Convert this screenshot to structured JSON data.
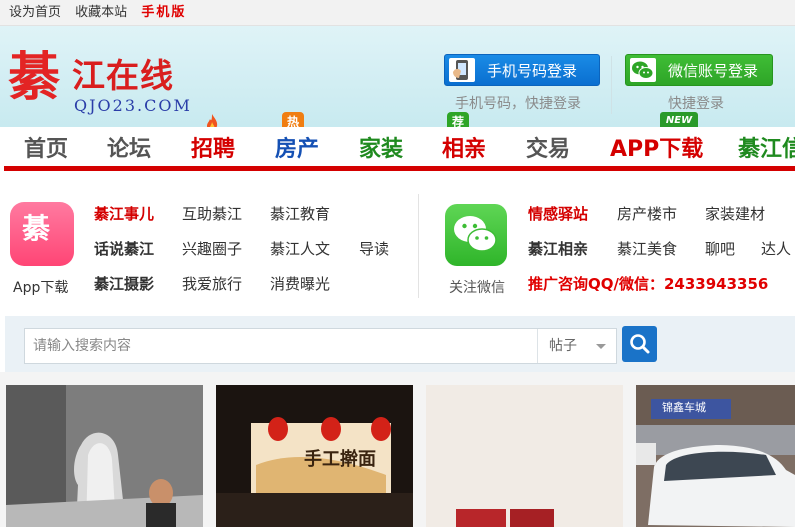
{
  "topbar": {
    "set_home": "设为首页",
    "bookmark": "收藏本站",
    "mobile": "手机版"
  },
  "logo": {
    "char": "綦",
    "name": "江在线",
    "domain": "QJO23.COM"
  },
  "login": {
    "phone_button": "手机号码登录",
    "phone_sub": "手机号码，快捷登录",
    "wechat_button": "微信账号登录",
    "wechat_sub": "快捷登录"
  },
  "nav": {
    "items": [
      {
        "label": "首页",
        "color": "#555555"
      },
      {
        "label": "论坛",
        "color": "#555555"
      },
      {
        "label": "招聘",
        "color": "#d40000"
      },
      {
        "label": "房产",
        "color": "#1450b4"
      },
      {
        "label": "家装",
        "color": "#1f8a1f"
      },
      {
        "label": "相亲",
        "color": "#d40000"
      },
      {
        "label": "交易",
        "color": "#555555"
      },
      {
        "label": "APP下载",
        "color": "#d40000"
      },
      {
        "label": "綦江信",
        "color": "#1f8a1f"
      }
    ],
    "badges": {
      "hot": "热",
      "recommend": "荐",
      "new": "NEW"
    }
  },
  "quick": {
    "app_caption": "App下载",
    "wx_caption": "关注微信",
    "left_rows": [
      [
        "綦江事儿",
        "互助綦江",
        "綦江教育"
      ],
      [
        "话说綦江",
        "兴趣圈子",
        "綦江人文",
        "导读"
      ],
      [
        "綦江摄影",
        "我爱旅行",
        "消费曝光"
      ]
    ],
    "right_rows": [
      [
        "情感驿站",
        "房产楼市",
        "家装建材"
      ],
      [
        "綦江相亲",
        "綦江美食",
        "聊吧",
        "达人"
      ],
      [
        "推广咨询QQ/微信：2433943356"
      ]
    ]
  },
  "search": {
    "placeholder": "请输入搜索内容",
    "type_selected": "帖子"
  },
  "photos": {
    "p2_sign": "手工擀面",
    "p4_sign": "锦鑫车城"
  },
  "colors": {
    "accent_red": "#d40000",
    "phone_blue": "#0a6fd0",
    "wechat_green": "#2ea527",
    "search_blue": "#1a73c8"
  }
}
